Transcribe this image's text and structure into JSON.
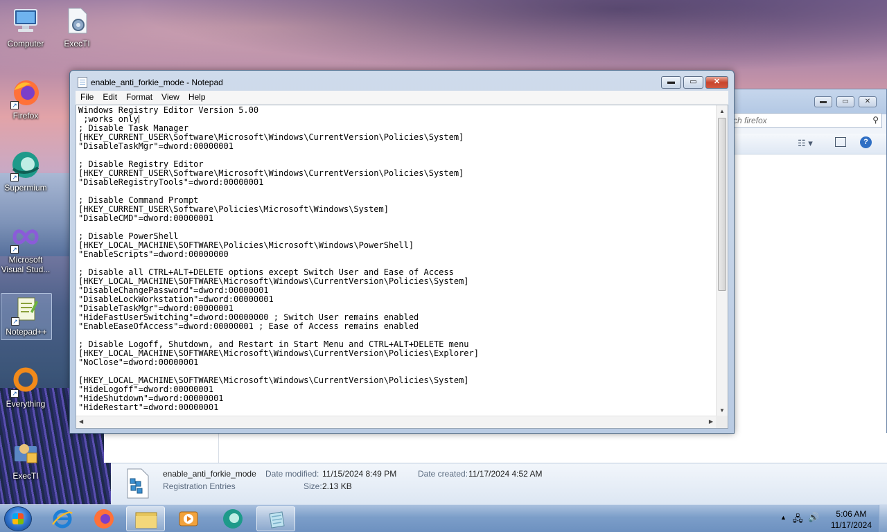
{
  "desktop": {
    "icons": [
      {
        "label": "Computer",
        "icon": "computer-icon"
      },
      {
        "label": "ExecTI",
        "icon": "exec-ti-file-icon"
      },
      {
        "label": "Firefox",
        "icon": "firefox-icon"
      },
      {
        "label": "Supermium",
        "icon": "supermium-icon"
      },
      {
        "label": "Microsoft Visual Stud...",
        "icon": "visual-studio-icon"
      },
      {
        "label": "Notepad++",
        "icon": "notepad-plus-plus-icon"
      },
      {
        "label": "Everything",
        "icon": "everything-search-icon"
      },
      {
        "label": "ExecTI",
        "icon": "exec-ti-shortcut-icon"
      }
    ]
  },
  "explorer": {
    "search_placeholder": "rch firefox",
    "details": {
      "file_name": "enable_anti_forkie_mode",
      "file_type": "Registration Entries",
      "date_modified_label": "Date modified:",
      "date_modified": "11/15/2024 8:49 PM",
      "date_created_label": "Date created:",
      "date_created": "11/17/2024 4:52 AM",
      "size_label": "Size:",
      "size": "2.13 KB"
    }
  },
  "notepad": {
    "title": "enable_anti_forkie_mode - Notepad",
    "menu": {
      "file": "File",
      "edit": "Edit",
      "format": "Format",
      "view": "View",
      "help": "Help"
    },
    "lines": [
      "Windows Registry Editor Version 5.00",
      " ;works only",
      "; Disable Task Manager",
      "[HKEY_CURRENT_USER\\Software\\Microsoft\\Windows\\CurrentVersion\\Policies\\System]",
      "\"DisableTaskMgr\"=dword:00000001",
      "",
      "; Disable Registry Editor",
      "[HKEY_CURRENT_USER\\Software\\Microsoft\\Windows\\CurrentVersion\\Policies\\System]",
      "\"DisableRegistryTools\"=dword:00000001",
      "",
      "; Disable Command Prompt",
      "[HKEY_CURRENT_USER\\Software\\Policies\\Microsoft\\Windows\\System]",
      "\"DisableCMD\"=dword:00000001",
      "",
      "; Disable PowerShell",
      "[HKEY_LOCAL_MACHINE\\SOFTWARE\\Policies\\Microsoft\\Windows\\PowerShell]",
      "\"EnableScripts\"=dword:00000000",
      "",
      "; Disable all CTRL+ALT+DELETE options except Switch User and Ease of Access",
      "[HKEY_LOCAL_MACHINE\\SOFTWARE\\Microsoft\\Windows\\CurrentVersion\\Policies\\System]",
      "\"DisableChangePassword\"=dword:00000001",
      "\"DisableLockWorkstation\"=dword:00000001",
      "\"DisableTaskMgr\"=dword:00000001",
      "\"HideFastUserSwitching\"=dword:00000000 ; Switch User remains enabled",
      "\"EnableEaseOfAccess\"=dword:00000001 ; Ease of Access remains enabled",
      "",
      "; Disable Logoff, Shutdown, and Restart in Start Menu and CTRL+ALT+DELETE menu",
      "[HKEY_LOCAL_MACHINE\\SOFTWARE\\Microsoft\\Windows\\CurrentVersion\\Policies\\Explorer]",
      "\"NoClose\"=dword:00000001",
      "",
      "[HKEY_LOCAL_MACHINE\\SOFTWARE\\Microsoft\\Windows\\CurrentVersion\\Policies\\System]",
      "\"HideLogoff\"=dword:00000001",
      "\"HideShutdown\"=dword:00000001",
      "\"HideRestart\"=dword:00000001"
    ]
  },
  "taskbar": {
    "pinned": [
      "internet-explorer-icon",
      "firefox-icon",
      "file-explorer-icon",
      "media-player-icon",
      "supermium-icon",
      "notepad-icon"
    ],
    "clock_time": "5:06 AM",
    "clock_date": "11/17/2024"
  }
}
